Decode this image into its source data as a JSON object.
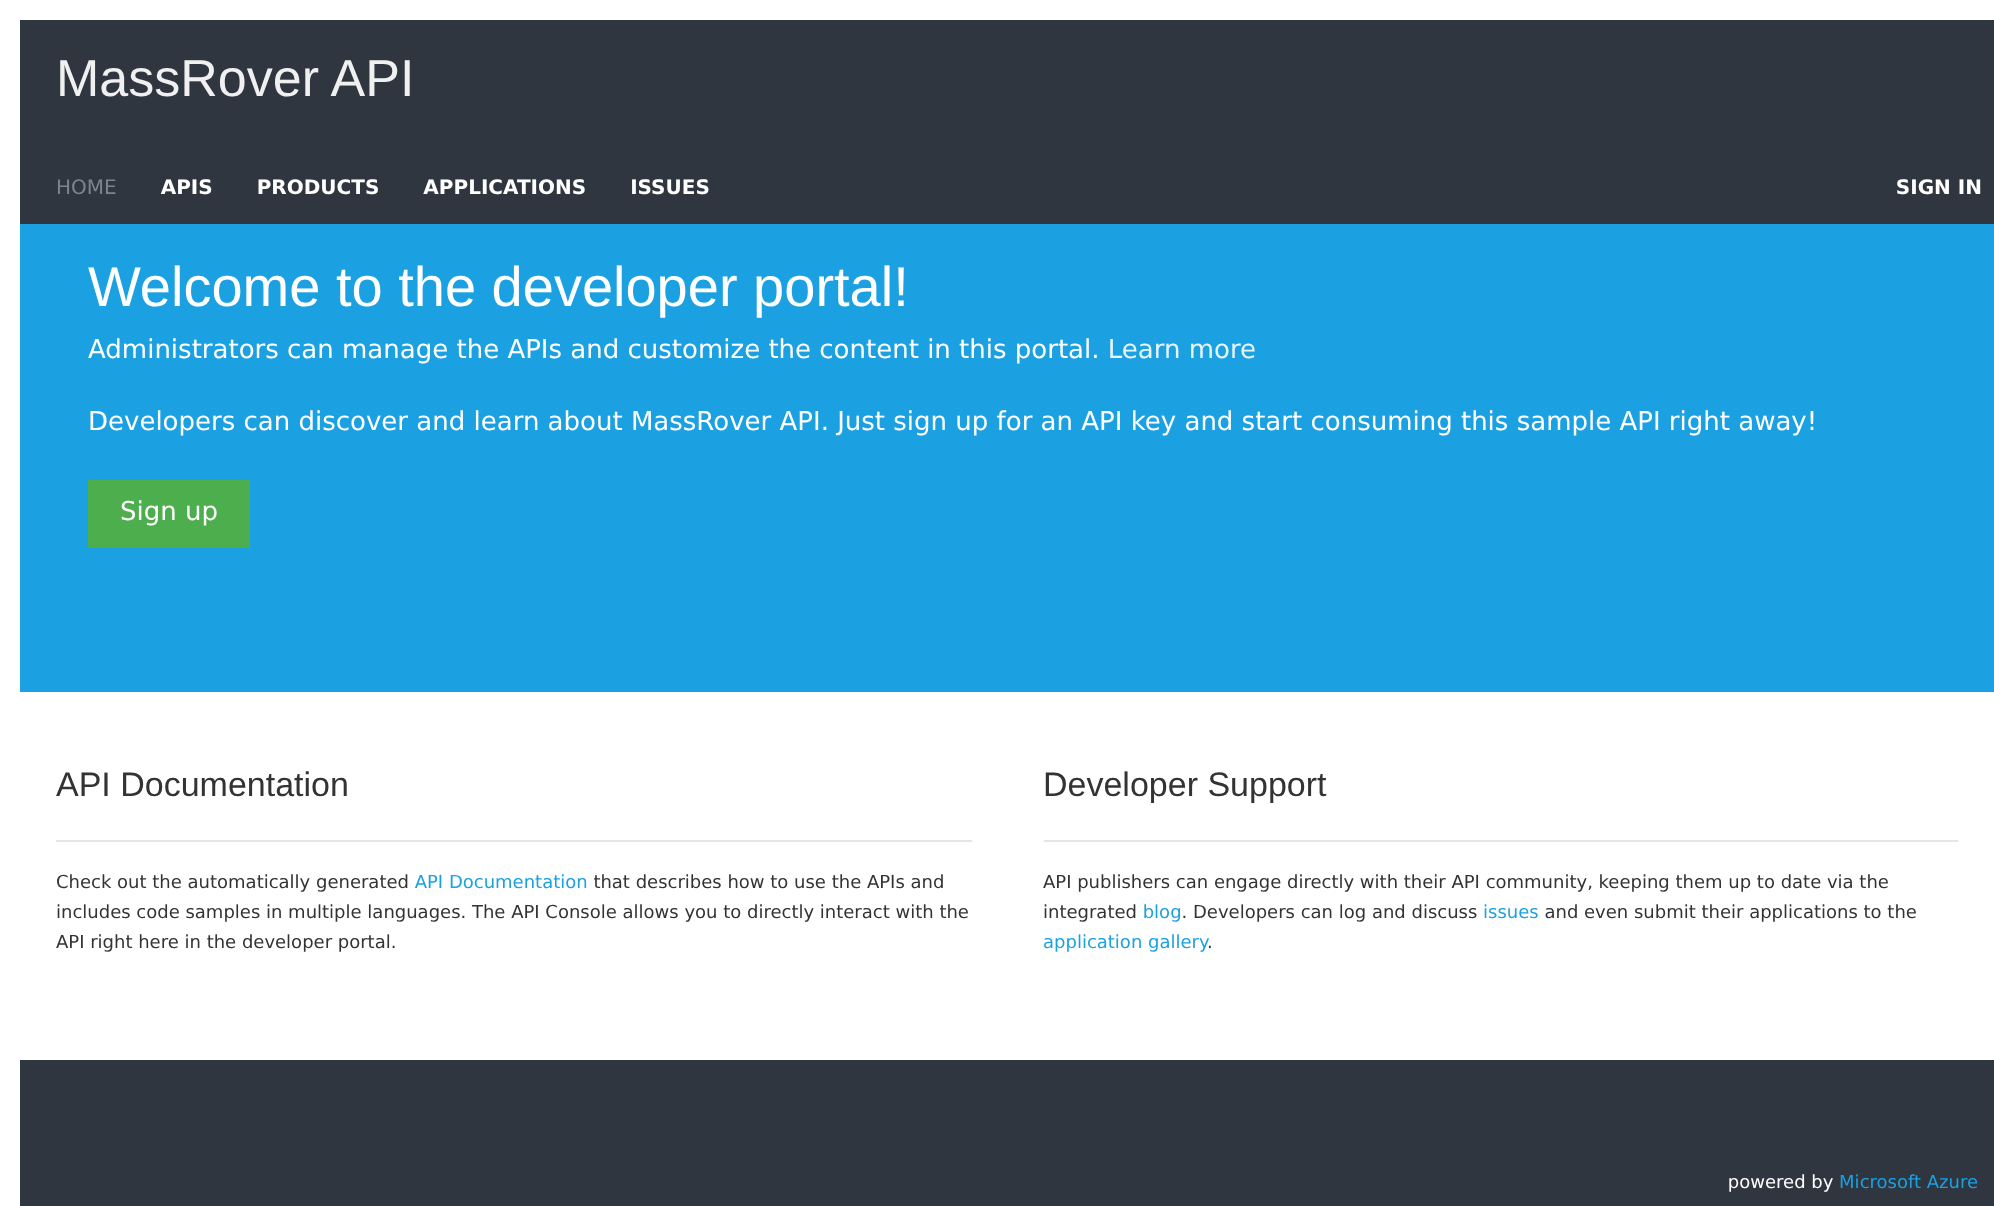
{
  "header": {
    "title": "MassRover API",
    "nav": [
      {
        "label": "HOME",
        "selected": true
      },
      {
        "label": "APIS",
        "selected": false
      },
      {
        "label": "PRODUCTS",
        "selected": false
      },
      {
        "label": "APPLICATIONS",
        "selected": false
      },
      {
        "label": "ISSUES",
        "selected": false
      }
    ],
    "sign_in": "SIGN IN"
  },
  "hero": {
    "heading": "Welcome to the developer portal!",
    "admin_text": [
      {
        "kind": "text",
        "text": "Administrators can manage the APIs and customize the content in this portal. "
      },
      {
        "kind": "link",
        "text": "Learn more"
      }
    ],
    "developer_text": "Developers can discover and learn about MassRover API. Just sign up for an API key and start consuming this sample API right away!",
    "button": "Sign up"
  },
  "sections": [
    {
      "title": "API Documentation",
      "parts": [
        {
          "kind": "text",
          "text": "Check out the automatically generated "
        },
        {
          "kind": "link",
          "text": "API Documentation"
        },
        {
          "kind": "text",
          "text": " that describes how to use the APIs and includes code samples in multiple languages. The API Console allows you to directly interact with the API right here in the developer portal."
        }
      ]
    },
    {
      "title": "Developer Support",
      "parts": [
        {
          "kind": "text",
          "text": "API publishers can engage directly with their API community, keeping them up to date via the integrated "
        },
        {
          "kind": "link",
          "text": "blog"
        },
        {
          "kind": "text",
          "text": ". Developers can log and discuss "
        },
        {
          "kind": "link",
          "text": "issues"
        },
        {
          "kind": "text",
          "text": " and even submit their applications to the "
        },
        {
          "kind": "link",
          "text": "application gallery"
        },
        {
          "kind": "text",
          "text": "."
        }
      ]
    }
  ],
  "footer": {
    "powered_by": [
      {
        "kind": "text",
        "text": "powered by "
      },
      {
        "kind": "link",
        "text": "Microsoft Azure"
      }
    ]
  }
}
